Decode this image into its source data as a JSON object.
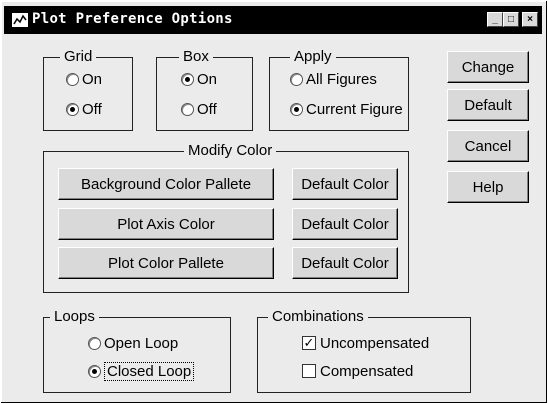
{
  "window": {
    "title": "Plot Preference Options",
    "icon": "app-window-icon",
    "controls": {
      "minimize": "_",
      "maximize": "□",
      "close": "×"
    }
  },
  "grid": {
    "legend": "Grid",
    "options": [
      {
        "label": "On",
        "selected": false
      },
      {
        "label": "Off",
        "selected": true
      }
    ]
  },
  "box": {
    "legend": "Box",
    "options": [
      {
        "label": "On",
        "selected": true
      },
      {
        "label": "Off",
        "selected": false
      }
    ]
  },
  "apply": {
    "legend": "Apply",
    "options": [
      {
        "label": "All Figures",
        "selected": false
      },
      {
        "label": "Current Figure",
        "selected": true
      }
    ]
  },
  "side_buttons": {
    "change": "Change",
    "default": "Default",
    "cancel": "Cancel",
    "help": "Help"
  },
  "modify_color": {
    "legend": "Modify Color",
    "rows": [
      {
        "action": "Background Color Pallete",
        "default": "Default Color"
      },
      {
        "action": "Plot Axis Color",
        "default": "Default Color"
      },
      {
        "action": "Plot Color Pallete",
        "default": "Default Color"
      }
    ]
  },
  "loops": {
    "legend": "Loops",
    "options": [
      {
        "label": "Open Loop",
        "selected": false
      },
      {
        "label": "Closed Loop",
        "selected": true
      }
    ]
  },
  "combinations": {
    "legend": "Combinations",
    "options": [
      {
        "label": "Uncompensated",
        "checked": true
      },
      {
        "label": "Compensated",
        "checked": false
      }
    ]
  }
}
